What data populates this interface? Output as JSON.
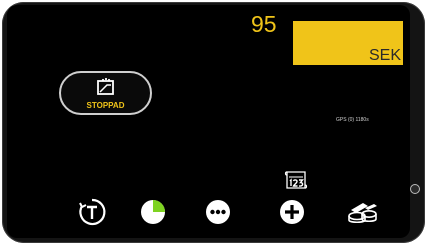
{
  "display": {
    "speed_value": "95",
    "unit_label": "SEK"
  },
  "status": {
    "label": "STOPPAD",
    "icon": "stopped-climb-icon"
  },
  "gps": {
    "text": "GPS (0) 1180s"
  },
  "toolbar": {
    "icons": [
      "timer-t-icon",
      "pie-progress-icon",
      "more-dots-icon",
      "add-plus-icon",
      "stack-coins-icon"
    ],
    "count_icon": "counter-123-icon",
    "pie_progress_fraction": 0.25
  },
  "colors": {
    "accent": "#f0c419",
    "screen": "#000000",
    "pie": "#7ed321",
    "icon": "#ffffff"
  }
}
